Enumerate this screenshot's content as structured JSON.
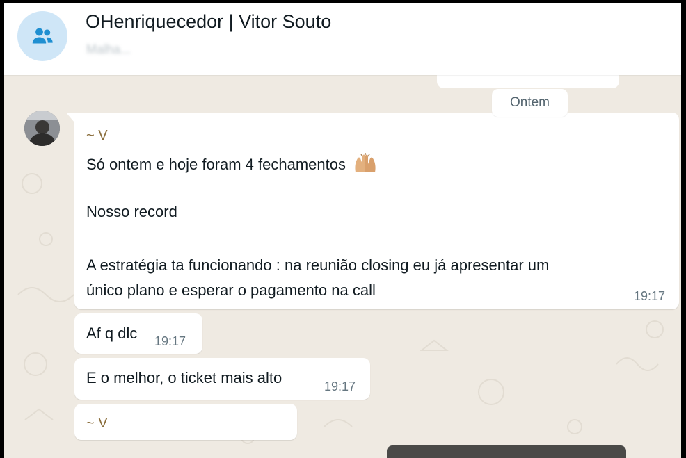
{
  "header": {
    "title": "OHenriquecedor | Vitor Souto",
    "subtitle": "Malha...",
    "avatar_icon": "group-icon"
  },
  "date_chip": "Ontem",
  "messages": [
    {
      "sender": "~ V",
      "line1": "Só ontem e hoje foram 4 fechamentos",
      "emoji": "raising-hands-emoji",
      "line2": "Nosso record",
      "line3a": "A estratégia ta funcionando  : na reunião closing eu já apresentar um",
      "line3b": "único plano e esperar o pagamento na call",
      "time": "19:17"
    },
    {
      "text": "Af q dlc",
      "time": "19:17"
    },
    {
      "text": "E o melhor, o ticket mais alto",
      "time": "19:17"
    },
    {
      "sender": "~ V"
    }
  ],
  "colors": {
    "chat_background": "#efeae2",
    "bubble": "#ffffff",
    "sender_name": "#8a6d3b",
    "timestamp": "#667781",
    "avatar_bg": "#cfe6f7",
    "avatar_icon": "#1f8fd1"
  }
}
